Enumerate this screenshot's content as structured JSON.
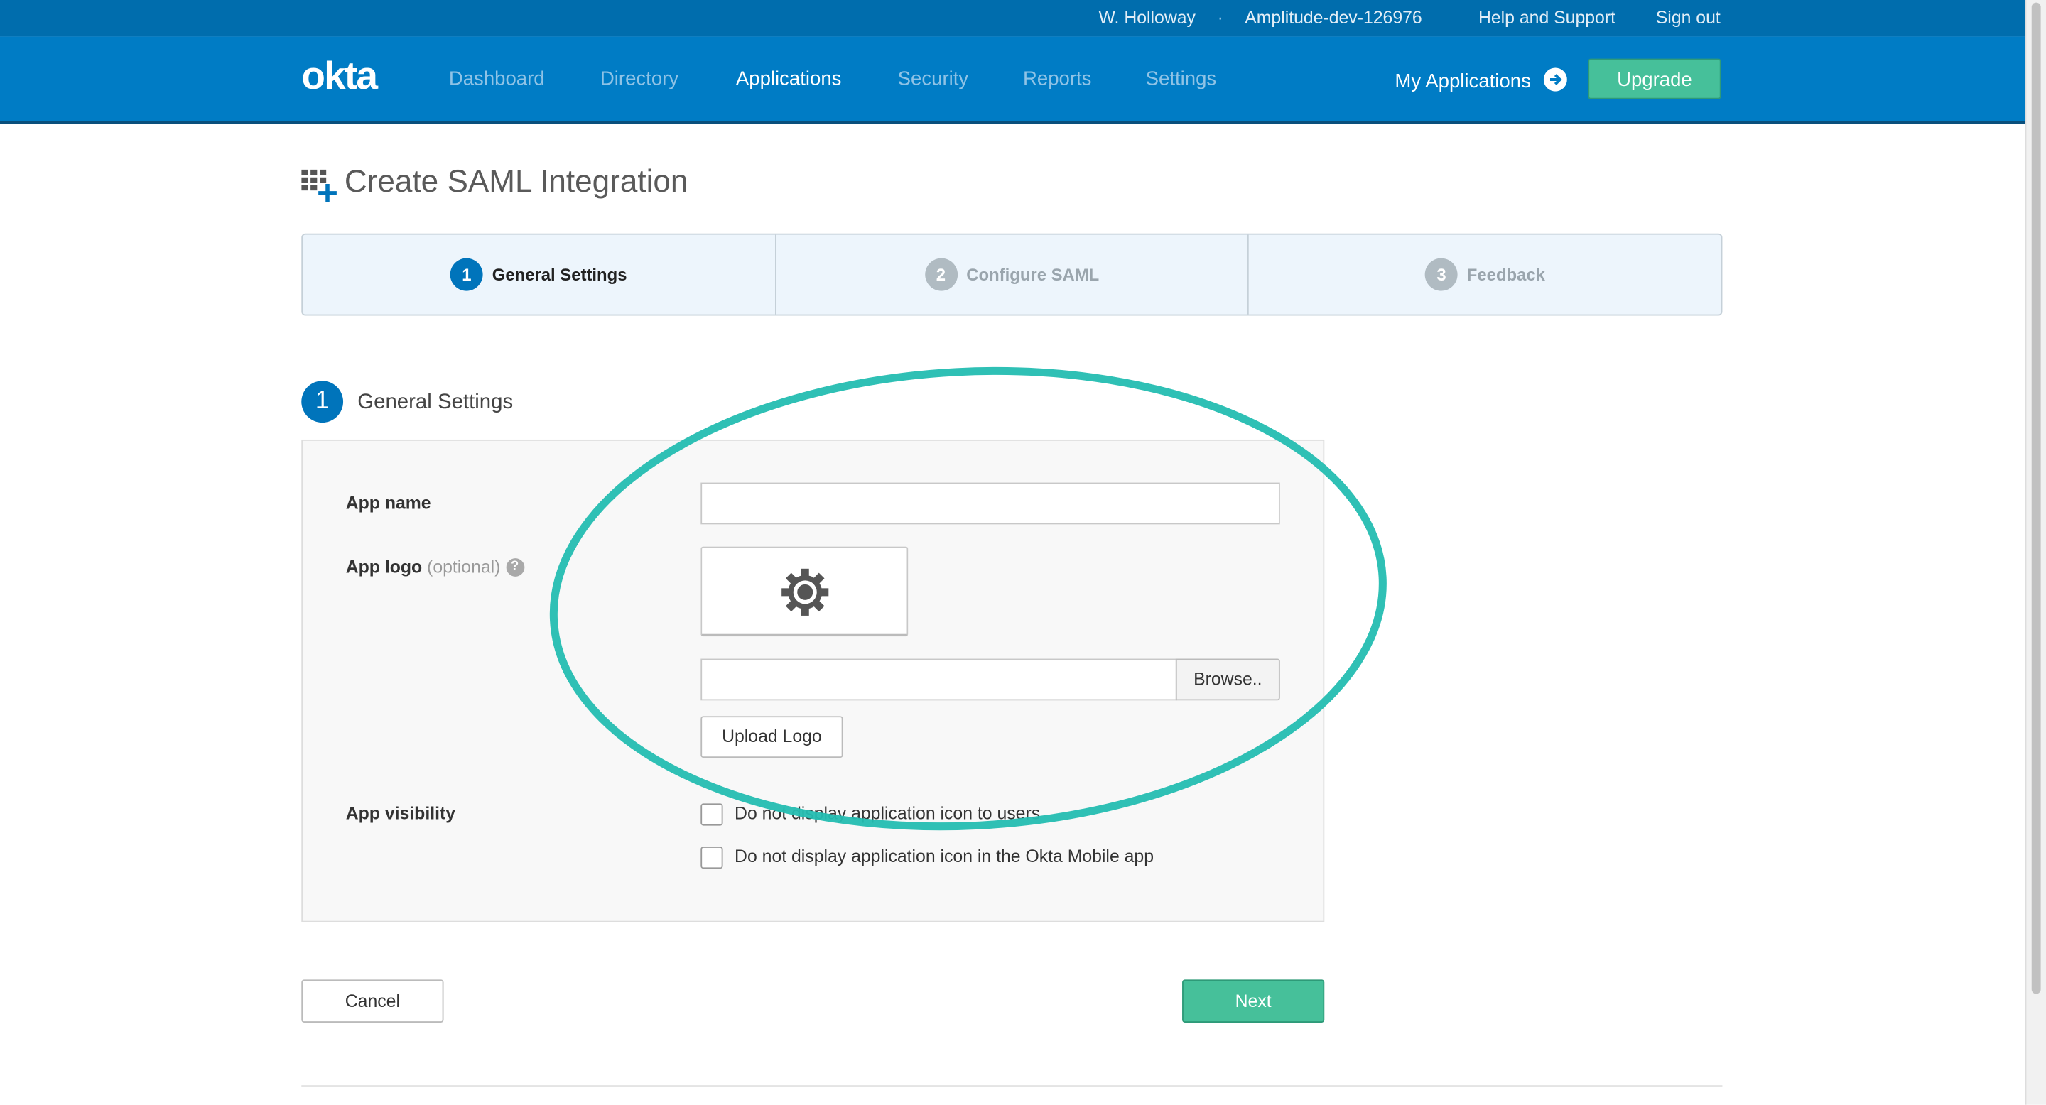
{
  "topbar": {
    "user": "W. Holloway",
    "separator": "·",
    "org": "Amplitude-dev-126976",
    "help": "Help and Support",
    "signout": "Sign out"
  },
  "nav": {
    "logo": "okta",
    "items": [
      "Dashboard",
      "Directory",
      "Applications",
      "Security",
      "Reports",
      "Settings"
    ],
    "active": "Applications",
    "my_applications": "My Applications",
    "upgrade": "Upgrade"
  },
  "page": {
    "title": "Create SAML Integration"
  },
  "steps": [
    {
      "num": "1",
      "label": "General Settings",
      "active": true
    },
    {
      "num": "2",
      "label": "Configure SAML",
      "active": false
    },
    {
      "num": "3",
      "label": "Feedback",
      "active": false
    }
  ],
  "section": {
    "num": "1",
    "title": "General Settings"
  },
  "form": {
    "app_name_label": "App name",
    "app_name_value": "",
    "app_logo_label": "App logo",
    "app_logo_optional": "(optional)",
    "help_glyph": "?",
    "browse": "Browse..",
    "upload_logo": "Upload Logo",
    "visibility_label": "App visibility",
    "visibility_options": [
      {
        "label": "Do not display application icon to users",
        "checked": false
      },
      {
        "label": "Do not display application icon in the Okta Mobile app",
        "checked": false
      }
    ]
  },
  "actions": {
    "cancel": "Cancel",
    "next": "Next"
  },
  "colors": {
    "nav": "#007cc5",
    "topbar": "#006dad",
    "accent": "#0074bb",
    "success": "#46c09a",
    "annotation": "#24bdb1"
  }
}
